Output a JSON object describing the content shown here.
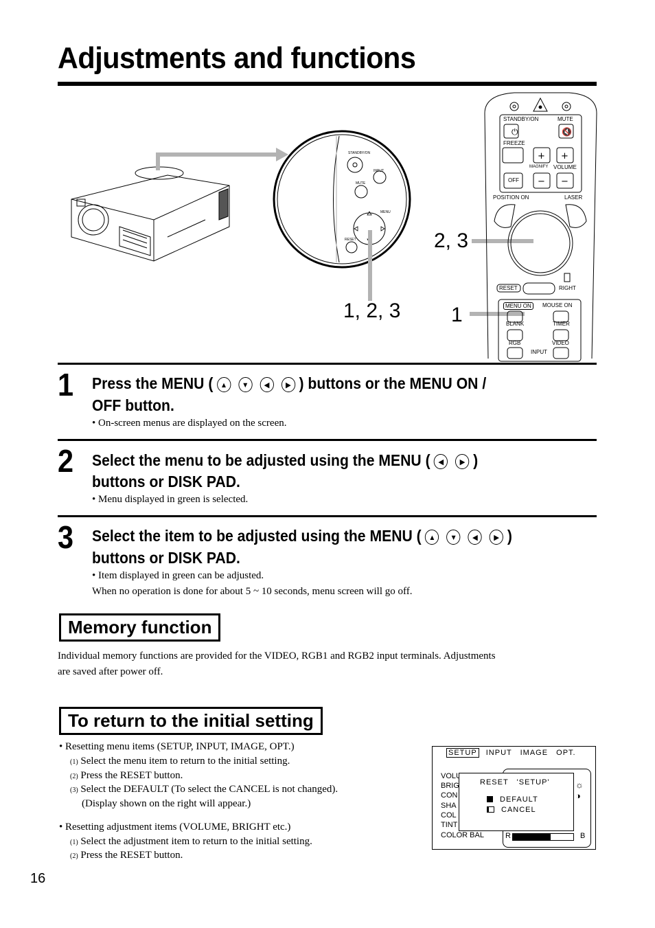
{
  "page": {
    "title": "Adjustments and functions",
    "page_number": "16"
  },
  "figure": {
    "callouts": [
      "2, 3",
      "1, 2, 3",
      "1"
    ],
    "control_panel": {
      "standby_on": "STANDBY/ON",
      "input": "INPUT",
      "mute": "MUTE",
      "menu": "MENU",
      "reset": "RESET"
    },
    "remote": {
      "standby_on": "STANDBY/ON",
      "mute": "MUTE",
      "freeze": "FREEZE",
      "magnify": "MAGNIFY",
      "volume": "VOLUME",
      "off": "OFF",
      "position_on": "POSITION  ON",
      "laser": "LASER",
      "reset": "RESET",
      "right": "RIGHT",
      "menu_on": "MENU  ON",
      "mouse_on": "MOUSE  ON",
      "blank": "BLANK",
      "timer": "TIMER",
      "rgb": "RGB",
      "video": "VIDEO",
      "input": "INPUT"
    }
  },
  "steps": [
    {
      "number": "1",
      "heading_line1_pre": "Press the MENU (",
      "heading_line1_post": ") buttons or the MENU ON /",
      "heading_line2": "OFF button.",
      "buttons": [
        "up",
        "down",
        "left",
        "right"
      ],
      "notes": [
        "• On-screen menus are displayed on the screen."
      ]
    },
    {
      "number": "2",
      "heading_line1_pre": "Select the menu to be adjusted using the MENU (",
      "heading_line1_post": ")",
      "heading_line2": "buttons or DISK PAD.",
      "buttons": [
        "left",
        "right"
      ],
      "notes": [
        "• Menu displayed  in green is selected."
      ]
    },
    {
      "number": "3",
      "heading_line1_pre": "Select the item to be adjusted using the MENU (",
      "heading_line1_post": ")",
      "heading_line2": "buttons or DISK PAD.",
      "buttons": [
        "up",
        "down",
        "left",
        "right"
      ],
      "notes": [
        "• Item displayed in green can be adjusted.",
        "When no operation is done for about 5 ~ 10 seconds, menu screen will go off."
      ]
    }
  ],
  "memory": {
    "heading": "Memory function",
    "text_line1": "Individual memory functions are provided for the VIDEO, RGB1 and RGB2 input terminals. Adjustments",
    "text_line2": "are saved after power off."
  },
  "reset_section": {
    "heading": "To return to the initial setting",
    "menu_items": {
      "bullet": "• Resetting menu items (SETUP, INPUT, IMAGE, OPT.)",
      "steps": [
        {
          "num": "(1)",
          "text": "Select the menu item to return to the initial setting."
        },
        {
          "num": "(2)",
          "text": "Press the RESET  button."
        },
        {
          "num": "(3)",
          "text": "Select the DEFAULT (To select the CANCEL is not changed)."
        }
      ],
      "continuation": "(Display shown on the right will appear.)"
    },
    "adjust_items": {
      "bullet": "• Resetting adjustment items (VOLUME, BRIGHT etc.)",
      "steps": [
        {
          "num": "(1)",
          "text": "Select the adjustment item to return to the initial setting."
        },
        {
          "num": "(2)",
          "text": "Press the RESET button."
        }
      ]
    }
  },
  "osd": {
    "tabs": [
      "SETUP",
      "INPUT",
      "IMAGE",
      "OPT."
    ],
    "selected_tab": "SETUP",
    "rows": [
      "VOLU",
      "BRIG",
      "CON",
      "SHA",
      "COL",
      "TINT",
      "COLOR BAL"
    ],
    "dialog_title": "RESET   'SETUP'",
    "options": [
      "DEFAULT",
      "CANCEL"
    ],
    "selected_option": "DEFAULT",
    "bar_left": "R",
    "bar_right": "B",
    "color_bal_fill": 0.62
  }
}
